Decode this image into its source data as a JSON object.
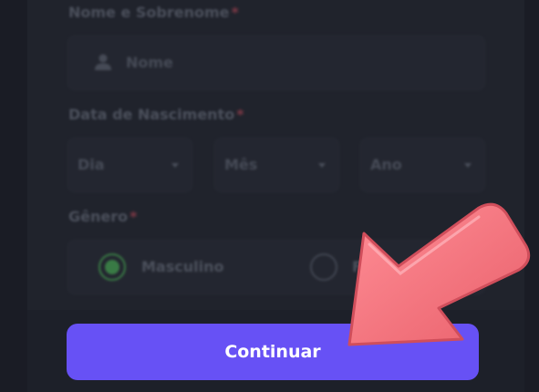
{
  "form": {
    "name_label": "Nome e Sobrenome",
    "required_mark": "*",
    "name_placeholder": "Nome",
    "birth_label": "Data de Nascimento",
    "day_select": "Dia",
    "month_select": "Mês",
    "year_select": "Ano",
    "gender_label": "Gênero",
    "gender_options": [
      {
        "label": "Masculino",
        "selected": true
      },
      {
        "label": "Fe",
        "selected": false
      }
    ]
  },
  "continue_button": "Continuar",
  "colors": {
    "accent": "#6751f5",
    "radio_selected": "#4ec25a",
    "pointer_arrow": "#f0707a"
  }
}
